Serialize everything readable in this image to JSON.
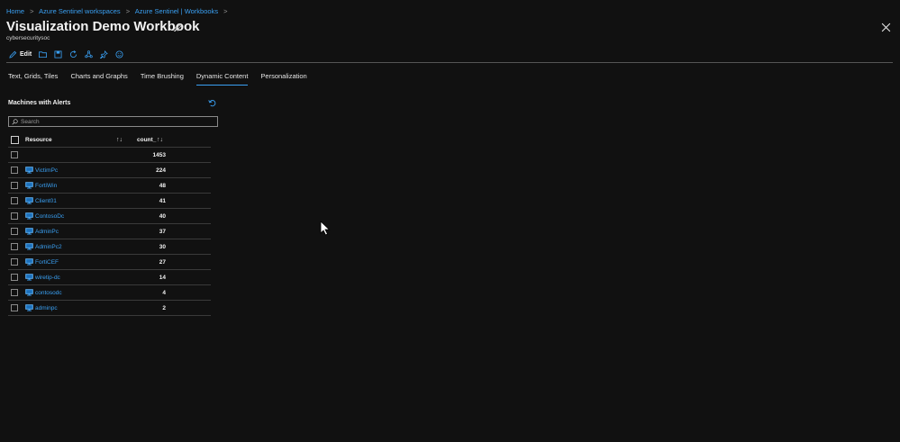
{
  "breadcrumb": {
    "items": [
      "Home",
      "Azure Sentinel workspaces",
      "Azure Sentinel | Workbooks"
    ],
    "separator": ">"
  },
  "header": {
    "title": "Visualization Demo Workbook",
    "subtitle": "cybersecuritysoc"
  },
  "toolbar": {
    "edit_label": "Edit",
    "icons": [
      "edit-icon",
      "open-icon",
      "save-icon",
      "refresh-icon",
      "share-icon",
      "pin-icon",
      "feedback-icon"
    ]
  },
  "tabs": [
    {
      "label": "Text, Grids, Tiles",
      "active": false
    },
    {
      "label": "Charts and Graphs",
      "active": false
    },
    {
      "label": "Time Brushing",
      "active": false
    },
    {
      "label": "Dynamic Content",
      "active": true
    },
    {
      "label": "Personalization",
      "active": false
    }
  ],
  "panel": {
    "title": "Machines with Alerts",
    "search_placeholder": "Search",
    "columns": {
      "resource": "Resource",
      "count": "count_"
    },
    "sort_glyph": "↑↓",
    "rows": [
      {
        "resource": "",
        "count": "1453",
        "icon": false
      },
      {
        "resource": "VictimPc",
        "count": "224",
        "icon": true
      },
      {
        "resource": "FortiWin",
        "count": "48",
        "icon": true
      },
      {
        "resource": "Client01",
        "count": "41",
        "icon": true
      },
      {
        "resource": "ContosoDc",
        "count": "40",
        "icon": true
      },
      {
        "resource": "AdminPc",
        "count": "37",
        "icon": true
      },
      {
        "resource": "AdminPc2",
        "count": "30",
        "icon": true
      },
      {
        "resource": "FortiCEF",
        "count": "27",
        "icon": true
      },
      {
        "resource": "wiretip-dc",
        "count": "14",
        "icon": true
      },
      {
        "resource": "contosodc",
        "count": "4",
        "icon": true
      },
      {
        "resource": "adminpc",
        "count": "2",
        "icon": true
      }
    ]
  },
  "colors": {
    "background": "#111111",
    "link": "#3aa0f3",
    "text": "#e6e6e6"
  }
}
